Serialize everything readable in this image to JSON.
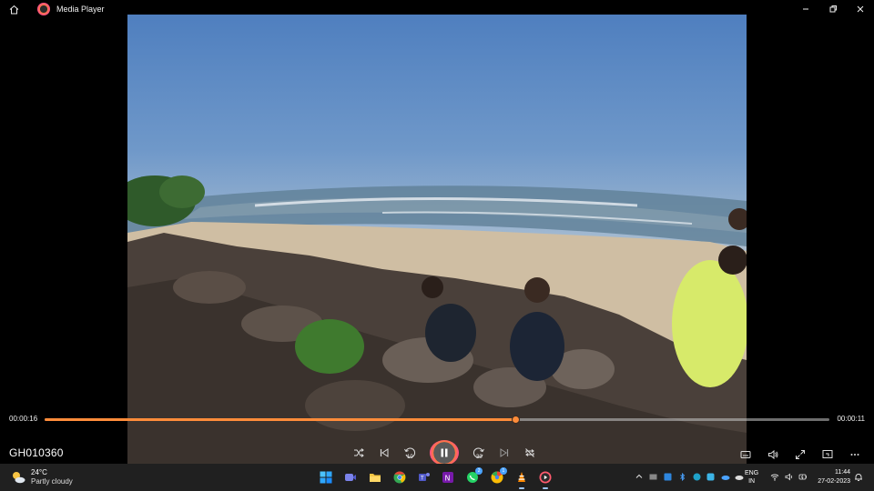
{
  "titlebar": {
    "app_title": "Media Player",
    "icons": [
      "home-icon",
      "media-player-logo-icon"
    ],
    "window_controls": [
      "minimize-icon",
      "restore-icon",
      "close-icon"
    ]
  },
  "player": {
    "elapsed": "00:00:16",
    "remaining": "00:00:11",
    "progress_fraction": 0.6,
    "media_name": "GH010360",
    "accent_color": "#ff8c3a",
    "controls": [
      "shuffle-icon",
      "previous-icon",
      "rewind-10-icon",
      "pause-icon",
      "forward-30-icon",
      "next-icon",
      "repeat-off-icon"
    ],
    "rewind_label": "10",
    "forward_label": "30",
    "right_controls": [
      "subtitles-icon",
      "volume-icon",
      "fullscreen-icon",
      "mini-player-icon",
      "more-icon"
    ]
  },
  "taskbar": {
    "weather": {
      "temp": "24°C",
      "condition": "Partly cloudy"
    },
    "apps": [
      {
        "name": "start",
        "color": "#3aa0ff"
      },
      {
        "name": "meet",
        "color": "#6264a7"
      },
      {
        "name": "file-explorer",
        "color": "#f4c542"
      },
      {
        "name": "chrome",
        "color": "#34a853"
      },
      {
        "name": "teams",
        "color": "#5059c9"
      },
      {
        "name": "onenote",
        "color": "#7719aa"
      },
      {
        "name": "whatsapp",
        "color": "#25d366",
        "badge": "2"
      },
      {
        "name": "chrome-profile",
        "color": "#ea4335",
        "badge": "1"
      },
      {
        "name": "vlc",
        "color": "#ff8800"
      },
      {
        "name": "media-player",
        "color": "#ff5a6e"
      }
    ],
    "language": {
      "line1": "ENG",
      "line2": "IN"
    },
    "clock": {
      "time": "11:44",
      "date": "27-02-2023"
    }
  }
}
